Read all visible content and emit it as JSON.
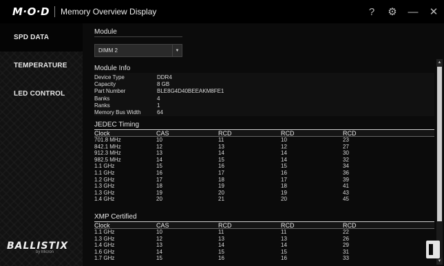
{
  "app": {
    "logo": "M·O·D",
    "title": "Memory Overview Display"
  },
  "titlebar": {
    "help": "?",
    "settings": "⚙",
    "minimize": "—",
    "close": "✕"
  },
  "sidebar": {
    "items": [
      {
        "label": "SPD DATA"
      },
      {
        "label": "TEMPERATURE"
      },
      {
        "label": "LED CONTROL"
      }
    ],
    "brand": {
      "name": "BALLISTIX",
      "sub": "by Micron"
    }
  },
  "module": {
    "label": "Module",
    "selected": "DIMM 2"
  },
  "module_info": {
    "label": "Module Info",
    "rows": [
      {
        "k": "Device Type",
        "v": "DDR4"
      },
      {
        "k": "Capacity",
        "v": "8 GB"
      },
      {
        "k": "Part Number",
        "v": "BLE8G4D40BEEAKM8FE1"
      },
      {
        "k": "Banks",
        "v": "4"
      },
      {
        "k": "Ranks",
        "v": "1"
      },
      {
        "k": "Memory Bus Width",
        "v": "64"
      }
    ]
  },
  "jedec": {
    "label": "JEDEC Timing",
    "headers": [
      "Clock",
      "CAS",
      "RCD",
      "RCD",
      "RCD"
    ],
    "rows": [
      [
        "701.8 MHz",
        "10",
        "11",
        "10",
        "23"
      ],
      [
        "842.1 MHz",
        "12",
        "13",
        "12",
        "27"
      ],
      [
        "912.3 MHz",
        "13",
        "14",
        "14",
        "30"
      ],
      [
        "982.5 MHz",
        "14",
        "15",
        "14",
        "32"
      ],
      [
        "1.1 GHz",
        "15",
        "16",
        "15",
        "34"
      ],
      [
        "1.1 GHz",
        "16",
        "17",
        "16",
        "36"
      ],
      [
        "1.2 GHz",
        "17",
        "18",
        "17",
        "39"
      ],
      [
        "1.3 GHz",
        "18",
        "19",
        "18",
        "41"
      ],
      [
        "1.3 GHz",
        "19",
        "20",
        "19",
        "43"
      ],
      [
        "1.4 GHz",
        "20",
        "21",
        "20",
        "45"
      ]
    ]
  },
  "xmp": {
    "label": "XMP Certified",
    "headers": [
      "Clock",
      "CAS",
      "RCD",
      "RCD",
      "RCD"
    ],
    "rows": [
      [
        "1.1 GHz",
        "10",
        "11",
        "11",
        "22"
      ],
      [
        "1.3 GHz",
        "12",
        "13",
        "13",
        "26"
      ],
      [
        "1.4 GHz",
        "13",
        "14",
        "14",
        "29"
      ],
      [
        "1.6 GHz",
        "14",
        "15",
        "15",
        "31"
      ],
      [
        "1.7 GHz",
        "15",
        "16",
        "16",
        "33"
      ]
    ]
  },
  "colors": {
    "background": "#0b0b0b",
    "titlebar": "#000000",
    "sidebar": "#121212",
    "scroll_thumb": "#cfcfcf"
  }
}
